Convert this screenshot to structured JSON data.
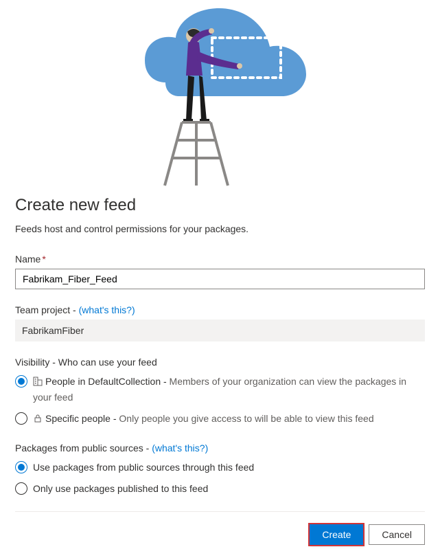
{
  "header": {
    "title": "Create new feed",
    "subtitle": "Feeds host and control permissions for your packages."
  },
  "name_field": {
    "label": "Name",
    "value": "Fabrikam_Fiber_Feed"
  },
  "team_project": {
    "label_prefix": "Team project - ",
    "help_link": "(what's this?)",
    "value": "FabrikamFiber"
  },
  "visibility": {
    "section_label": "Visibility - Who can use your feed",
    "options": [
      {
        "label": "People in DefaultCollection - ",
        "desc": "Members of your organization can view the packages in your feed",
        "selected": true
      },
      {
        "label": "Specific people - ",
        "desc": "Only people you give access to will be able to view this feed",
        "selected": false
      }
    ]
  },
  "packages": {
    "section_label_prefix": "Packages from public sources - ",
    "help_link": "(what's this?)",
    "options": [
      {
        "label": "Use packages from public sources through this feed",
        "selected": true
      },
      {
        "label": "Only use packages published to this feed",
        "selected": false
      }
    ]
  },
  "buttons": {
    "create": "Create",
    "cancel": "Cancel"
  }
}
